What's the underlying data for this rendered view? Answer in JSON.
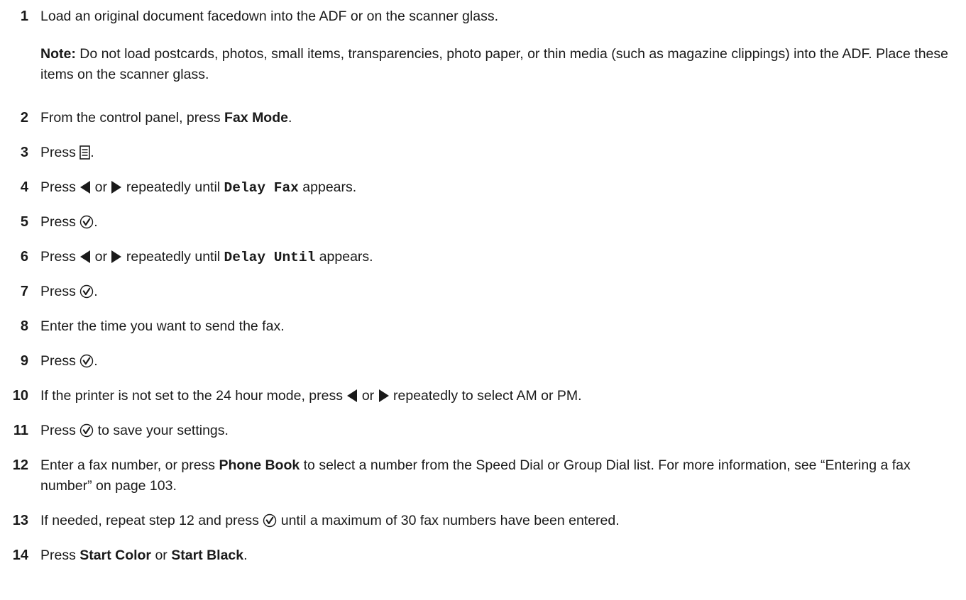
{
  "steps": [
    {
      "num": "1",
      "text": "Load an original document facedown into the ADF or on the scanner glass."
    },
    {
      "note_label": "Note:",
      "note_text": " Do not load postcards, photos, small items, transparencies, photo paper, or thin media (such as magazine clippings) into the ADF. Place these items on the scanner glass."
    },
    {
      "num": "2",
      "pre": "From the control panel, press ",
      "bold": "Fax Mode",
      "post": "."
    },
    {
      "num": "3",
      "pre": "Press ",
      "post": "."
    },
    {
      "num": "4",
      "pre": "Press ",
      "or": " or ",
      "mid": " repeatedly until ",
      "mono": "Delay Fax",
      "post": " appears."
    },
    {
      "num": "5",
      "pre": "Press ",
      "post": "."
    },
    {
      "num": "6",
      "pre": "Press ",
      "or": " or ",
      "mid": " repeatedly until ",
      "mono": "Delay Until",
      "post": " appears."
    },
    {
      "num": "7",
      "pre": "Press ",
      "post": "."
    },
    {
      "num": "8",
      "text": "Enter the time you want to send the fax."
    },
    {
      "num": "9",
      "pre": "Press ",
      "post": "."
    },
    {
      "num": "10",
      "pre": "If the printer is not set to the 24 hour mode, press ",
      "or": " or ",
      "post": " repeatedly to select AM or PM."
    },
    {
      "num": "11",
      "pre": "Press ",
      "post": " to save your settings."
    },
    {
      "num": "12",
      "pre": "Enter a fax number, or press ",
      "bold": "Phone Book",
      "post": " to select a number from the Speed Dial or Group Dial list. For more information, see “Entering a fax number” on page 103."
    },
    {
      "num": "13",
      "pre": "If needed, repeat step 12 and press ",
      "post": " until a maximum of 30 fax numbers have been entered."
    },
    {
      "num": "14",
      "pre": "Press ",
      "bold": "Start Color",
      "or_text": " or ",
      "bold2": "Start Black",
      "post": "."
    }
  ],
  "icons": {
    "menu": "menu-icon",
    "left": "left-arrow-icon",
    "right": "right-arrow-icon",
    "select": "select-checkmark-icon"
  },
  "colors": {
    "text": "#1a1a1a",
    "icon": "#1a1a1a"
  }
}
